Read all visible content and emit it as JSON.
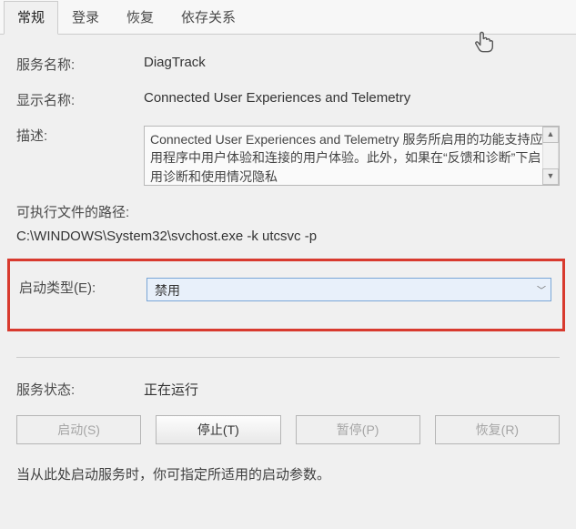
{
  "tabs": {
    "general": "常规",
    "logon": "登录",
    "recovery": "恢复",
    "dependencies": "依存关系"
  },
  "labels": {
    "service_name": "服务名称:",
    "display_name": "显示名称:",
    "description": "描述:",
    "exe_path": "可执行文件的路径:",
    "startup_type": "启动类型(E):",
    "service_status": "服务状态:"
  },
  "values": {
    "service_name": "DiagTrack",
    "display_name": "Connected User Experiences and Telemetry",
    "description": "Connected User Experiences and Telemetry 服务所启用的功能支持应用程序中用户体验和连接的用户体验。此外，如果在“反馈和诊断”下启用诊断和使用情况隐私",
    "exe_path": "C:\\WINDOWS\\System32\\svchost.exe -k utcsvc -p",
    "startup_type": "禁用",
    "service_status": "正在运行"
  },
  "buttons": {
    "start": "启动(S)",
    "stop": "停止(T)",
    "pause": "暂停(P)",
    "resume": "恢复(R)"
  },
  "note": "当从此处启动服务时，你可指定所适用的启动参数。"
}
